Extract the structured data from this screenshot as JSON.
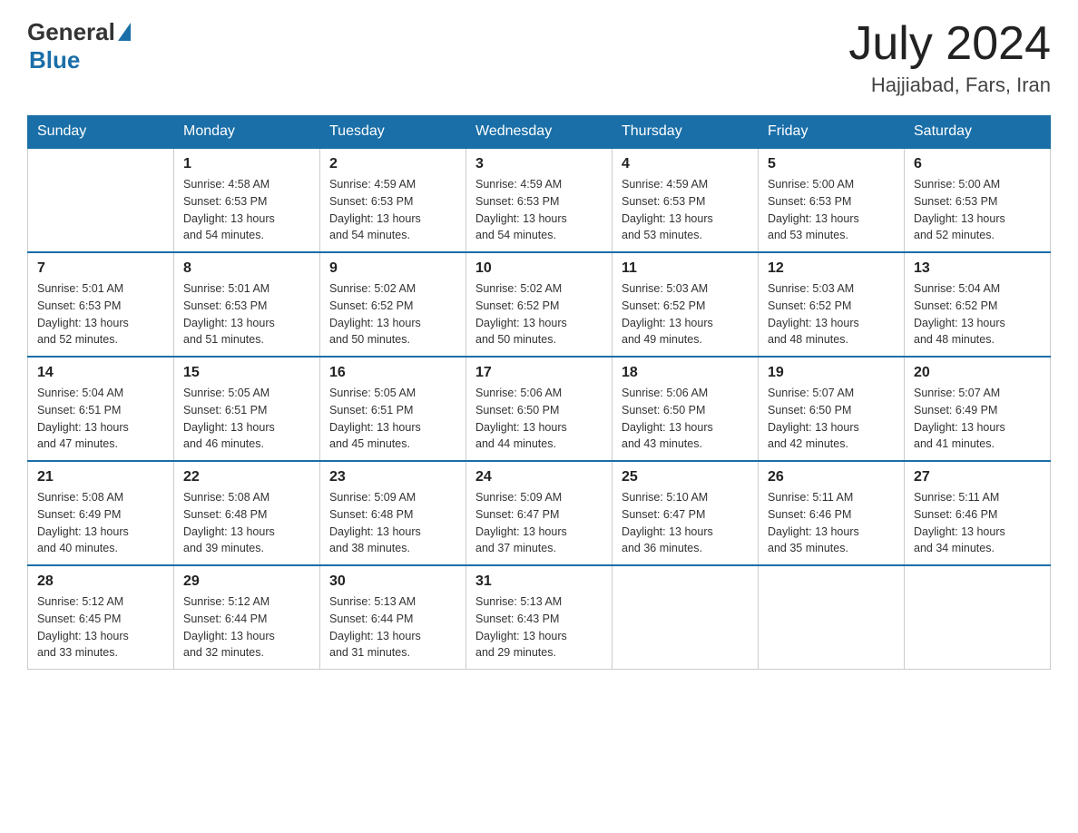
{
  "header": {
    "logo_general": "General",
    "logo_blue": "Blue",
    "month_year": "July 2024",
    "location": "Hajjiabad, Fars, Iran"
  },
  "weekdays": [
    "Sunday",
    "Monday",
    "Tuesday",
    "Wednesday",
    "Thursday",
    "Friday",
    "Saturday"
  ],
  "weeks": [
    [
      null,
      {
        "day": "1",
        "sunrise": "4:58 AM",
        "sunset": "6:53 PM",
        "daylight": "13 hours and 54 minutes."
      },
      {
        "day": "2",
        "sunrise": "4:59 AM",
        "sunset": "6:53 PM",
        "daylight": "13 hours and 54 minutes."
      },
      {
        "day": "3",
        "sunrise": "4:59 AM",
        "sunset": "6:53 PM",
        "daylight": "13 hours and 54 minutes."
      },
      {
        "day": "4",
        "sunrise": "4:59 AM",
        "sunset": "6:53 PM",
        "daylight": "13 hours and 53 minutes."
      },
      {
        "day": "5",
        "sunrise": "5:00 AM",
        "sunset": "6:53 PM",
        "daylight": "13 hours and 53 minutes."
      },
      {
        "day": "6",
        "sunrise": "5:00 AM",
        "sunset": "6:53 PM",
        "daylight": "13 hours and 52 minutes."
      }
    ],
    [
      {
        "day": "7",
        "sunrise": "5:01 AM",
        "sunset": "6:53 PM",
        "daylight": "13 hours and 52 minutes."
      },
      {
        "day": "8",
        "sunrise": "5:01 AM",
        "sunset": "6:53 PM",
        "daylight": "13 hours and 51 minutes."
      },
      {
        "day": "9",
        "sunrise": "5:02 AM",
        "sunset": "6:52 PM",
        "daylight": "13 hours and 50 minutes."
      },
      {
        "day": "10",
        "sunrise": "5:02 AM",
        "sunset": "6:52 PM",
        "daylight": "13 hours and 50 minutes."
      },
      {
        "day": "11",
        "sunrise": "5:03 AM",
        "sunset": "6:52 PM",
        "daylight": "13 hours and 49 minutes."
      },
      {
        "day": "12",
        "sunrise": "5:03 AM",
        "sunset": "6:52 PM",
        "daylight": "13 hours and 48 minutes."
      },
      {
        "day": "13",
        "sunrise": "5:04 AM",
        "sunset": "6:52 PM",
        "daylight": "13 hours and 48 minutes."
      }
    ],
    [
      {
        "day": "14",
        "sunrise": "5:04 AM",
        "sunset": "6:51 PM",
        "daylight": "13 hours and 47 minutes."
      },
      {
        "day": "15",
        "sunrise": "5:05 AM",
        "sunset": "6:51 PM",
        "daylight": "13 hours and 46 minutes."
      },
      {
        "day": "16",
        "sunrise": "5:05 AM",
        "sunset": "6:51 PM",
        "daylight": "13 hours and 45 minutes."
      },
      {
        "day": "17",
        "sunrise": "5:06 AM",
        "sunset": "6:50 PM",
        "daylight": "13 hours and 44 minutes."
      },
      {
        "day": "18",
        "sunrise": "5:06 AM",
        "sunset": "6:50 PM",
        "daylight": "13 hours and 43 minutes."
      },
      {
        "day": "19",
        "sunrise": "5:07 AM",
        "sunset": "6:50 PM",
        "daylight": "13 hours and 42 minutes."
      },
      {
        "day": "20",
        "sunrise": "5:07 AM",
        "sunset": "6:49 PM",
        "daylight": "13 hours and 41 minutes."
      }
    ],
    [
      {
        "day": "21",
        "sunrise": "5:08 AM",
        "sunset": "6:49 PM",
        "daylight": "13 hours and 40 minutes."
      },
      {
        "day": "22",
        "sunrise": "5:08 AM",
        "sunset": "6:48 PM",
        "daylight": "13 hours and 39 minutes."
      },
      {
        "day": "23",
        "sunrise": "5:09 AM",
        "sunset": "6:48 PM",
        "daylight": "13 hours and 38 minutes."
      },
      {
        "day": "24",
        "sunrise": "5:09 AM",
        "sunset": "6:47 PM",
        "daylight": "13 hours and 37 minutes."
      },
      {
        "day": "25",
        "sunrise": "5:10 AM",
        "sunset": "6:47 PM",
        "daylight": "13 hours and 36 minutes."
      },
      {
        "day": "26",
        "sunrise": "5:11 AM",
        "sunset": "6:46 PM",
        "daylight": "13 hours and 35 minutes."
      },
      {
        "day": "27",
        "sunrise": "5:11 AM",
        "sunset": "6:46 PM",
        "daylight": "13 hours and 34 minutes."
      }
    ],
    [
      {
        "day": "28",
        "sunrise": "5:12 AM",
        "sunset": "6:45 PM",
        "daylight": "13 hours and 33 minutes."
      },
      {
        "day": "29",
        "sunrise": "5:12 AM",
        "sunset": "6:44 PM",
        "daylight": "13 hours and 32 minutes."
      },
      {
        "day": "30",
        "sunrise": "5:13 AM",
        "sunset": "6:44 PM",
        "daylight": "13 hours and 31 minutes."
      },
      {
        "day": "31",
        "sunrise": "5:13 AM",
        "sunset": "6:43 PM",
        "daylight": "13 hours and 29 minutes."
      },
      null,
      null,
      null
    ]
  ],
  "labels": {
    "sunrise_prefix": "Sunrise: ",
    "sunset_prefix": "Sunset: ",
    "daylight_prefix": "Daylight: "
  }
}
